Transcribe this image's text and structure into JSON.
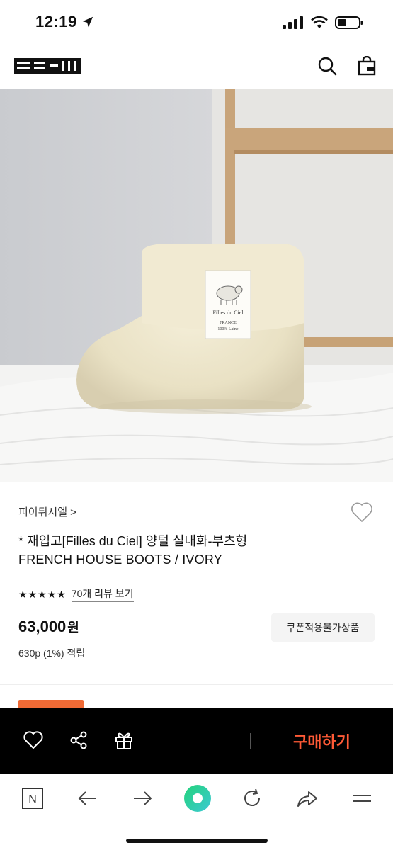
{
  "status_bar": {
    "time": "12:19"
  },
  "product": {
    "brand_link": "피이뒤시엘 >",
    "title_line1": "* 재입고[Filles du Ciel] 양털 실내화-부츠형",
    "title_line2": "FRENCH HOUSE BOOTS / IVORY",
    "rating_stars": 5,
    "review_link": "70개 리뷰 보기",
    "price": "63,000",
    "price_unit": "원",
    "points": "630p (1%) 적립",
    "coupon_badge": "쿠폰적용불가상품",
    "tag_line1": "Filles du Ciel",
    "tag_line2": "FRANCE",
    "tag_line3": "100% Laine"
  },
  "buy_bar": {
    "buy_label": "구매하기"
  },
  "colors": {
    "accent": "#ff5a36",
    "bar_bg": "#000000",
    "toggle_green": "#3ccf8e"
  },
  "icons": {
    "header": [
      "search-icon",
      "shopping-bag-icon"
    ],
    "buy_bar": [
      "heart-icon",
      "share-icon",
      "gift-icon"
    ],
    "browser": [
      "naver-n-icon",
      "back-arrow-icon",
      "forward-arrow-icon",
      "home-green-icon",
      "refresh-icon",
      "share-arrow-icon",
      "menu-icon"
    ]
  }
}
